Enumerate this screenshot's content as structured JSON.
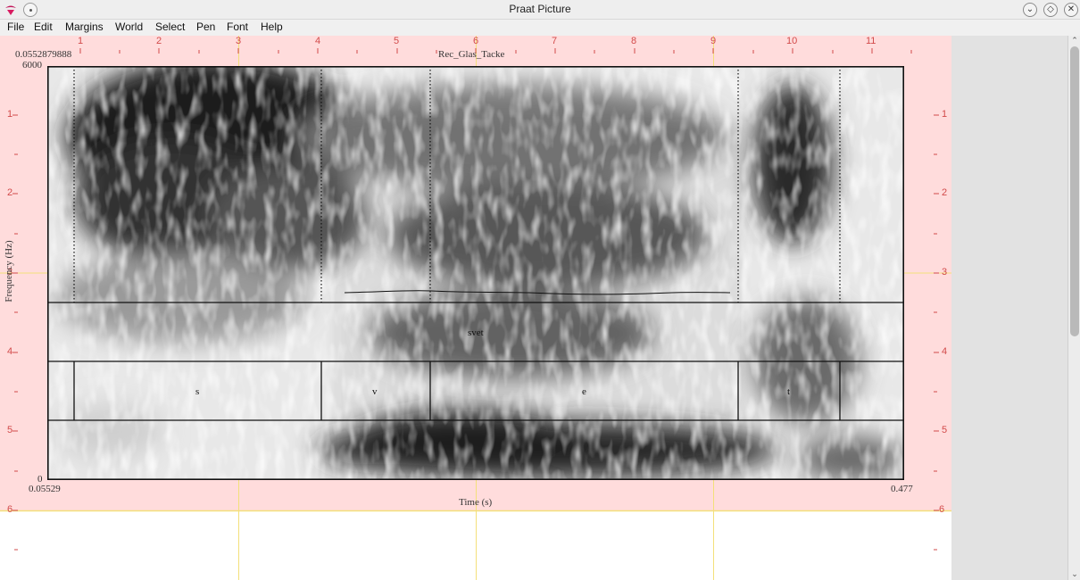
{
  "window": {
    "title": "Praat Picture"
  },
  "menu": [
    "File",
    "Edit",
    "Margins",
    "World",
    "Select",
    "Pen",
    "Font",
    "Help"
  ],
  "ruler": {
    "top": [
      "1",
      "2",
      "3",
      "4",
      "5",
      "6",
      "7",
      "8",
      "9",
      "10",
      "11"
    ],
    "left": [
      "1",
      "2",
      "3",
      "4",
      "5",
      "6"
    ],
    "right": [
      "1",
      "2",
      "3",
      "4",
      "5",
      "6"
    ]
  },
  "figure": {
    "time_start_top": "0.0552879888",
    "title": "Rec_Glas_Tacke",
    "freq_max": "6000",
    "freq_min": "0",
    "ylabel": "Frequency (Hz)",
    "xlabel": "Time (s)",
    "x_start": "0.05529",
    "x_end": "0.477",
    "word_tier": [
      "svet"
    ],
    "phone_tier": [
      "s",
      "v",
      "e",
      "t"
    ]
  },
  "colors": {
    "margin_pink": "#ffdcdc",
    "ruler_red": "#d24a4a",
    "selection_yellow": "#f3e07a",
    "menubar": "#f0f0f0"
  },
  "icons": {
    "app": "praat-app-icon",
    "pin": "pin-icon",
    "minimize": "minimize-icon",
    "maximize": "maximize-icon",
    "close": "close-icon"
  }
}
